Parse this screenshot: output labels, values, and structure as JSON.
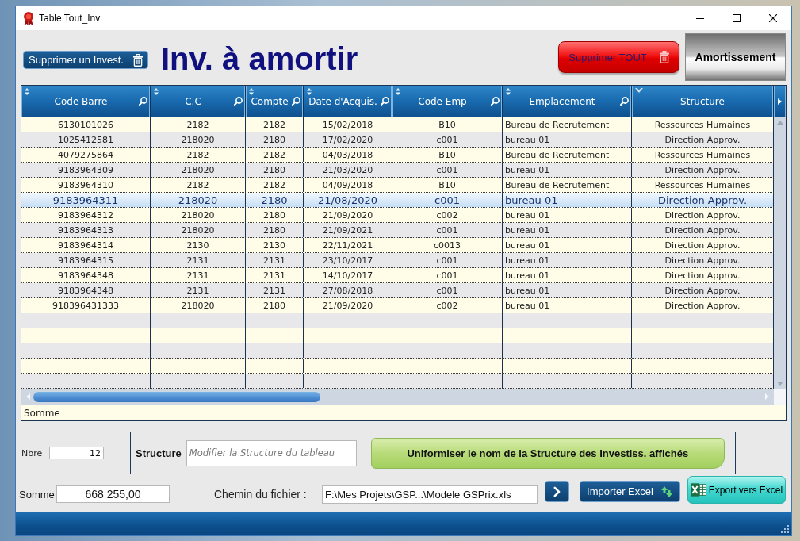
{
  "window": {
    "title": "Table Tout_Inv"
  },
  "toolbar": {
    "delete_one_button": "Supprimer un Invest.",
    "heading": "Inv. à amortir",
    "delete_all_button": "Supprimer TOUT",
    "depreciation_button": "Amortissement"
  },
  "table": {
    "columns": [
      {
        "label": "Code Barre",
        "sorted": false,
        "searchable": true
      },
      {
        "label": "C.C",
        "sorted": false,
        "searchable": true
      },
      {
        "label": "Compte",
        "sorted": false,
        "searchable": true
      },
      {
        "label": "Date d'Acquis.",
        "sorted": false,
        "searchable": true
      },
      {
        "label": "Code Emp",
        "sorted": false,
        "searchable": true
      },
      {
        "label": "Emplacement",
        "sorted": false,
        "searchable": true
      },
      {
        "label": "Structure",
        "sorted": true,
        "searchable": false
      }
    ],
    "rows": [
      {
        "cells": [
          "6130101026",
          "2182",
          "2182",
          "15/02/2018",
          "B10",
          "Bureau de Recrutement",
          "Ressources Humaines"
        ],
        "selected": false
      },
      {
        "cells": [
          "1025412581",
          "218020",
          "2180",
          "17/02/2020",
          "c001",
          "bureau 01",
          "Direction Approv."
        ],
        "selected": false
      },
      {
        "cells": [
          "4079275864",
          "2182",
          "2182",
          "04/03/2018",
          "B10",
          "Bureau de Recrutement",
          "Ressources Humaines"
        ],
        "selected": false
      },
      {
        "cells": [
          "9183964309",
          "218020",
          "2180",
          "21/03/2020",
          "c001",
          "bureau 01",
          "Direction Approv."
        ],
        "selected": false
      },
      {
        "cells": [
          "9183964310",
          "2182",
          "2182",
          "04/09/2018",
          "B10",
          "Bureau de Recrutement",
          "Ressources Humaines"
        ],
        "selected": false
      },
      {
        "cells": [
          "9183964311",
          "218020",
          "2180",
          "21/08/2020",
          "c001",
          "bureau 01",
          "Direction Approv."
        ],
        "selected": true
      },
      {
        "cells": [
          "9183964312",
          "218020",
          "2180",
          "21/09/2020",
          "c002",
          "bureau 01",
          "Direction Approv."
        ],
        "selected": false
      },
      {
        "cells": [
          "9183964313",
          "218020",
          "2180",
          "21/09/2021",
          "c001",
          "bureau 01",
          "Direction Approv."
        ],
        "selected": false
      },
      {
        "cells": [
          "9183964314",
          "2130",
          "2130",
          "22/11/2021",
          "c0013",
          "bureau 01",
          "Direction Approv."
        ],
        "selected": false
      },
      {
        "cells": [
          "9183964315",
          "2131",
          "2131",
          "23/10/2017",
          "c001",
          "bureau 01",
          "Direction Approv."
        ],
        "selected": false
      },
      {
        "cells": [
          "9183964348",
          "2131",
          "2131",
          "14/10/2017",
          "c001",
          "bureau 01",
          "Direction Approv."
        ],
        "selected": false
      },
      {
        "cells": [
          "9183964348",
          "2131",
          "2131",
          "27/08/2018",
          "c001",
          "bureau 01",
          "Direction Approv."
        ],
        "selected": false
      },
      {
        "cells": [
          "918396431333",
          "218020",
          "2180",
          "21/09/2020",
          "c002",
          "bureau 01",
          "Direction Approv."
        ],
        "selected": false
      }
    ],
    "summary_label": "Somme"
  },
  "footer": {
    "count": {
      "label": "Nbre",
      "value": "12"
    },
    "structure": {
      "label": "Structure",
      "placeholder": "Modifier la Structure du tableau",
      "apply_button": "Uniformiser le nom de la Structure des Investiss. affichés"
    },
    "total": {
      "label": "Somme",
      "value": "668 255,00"
    },
    "file_path": {
      "label": "Chemin du fichier :",
      "value": "F:\\Mes Projets\\GSP...\\Modele GSPrix.xls"
    },
    "import_button": "Importer Excel",
    "export_button": "Export vers Excel"
  }
}
